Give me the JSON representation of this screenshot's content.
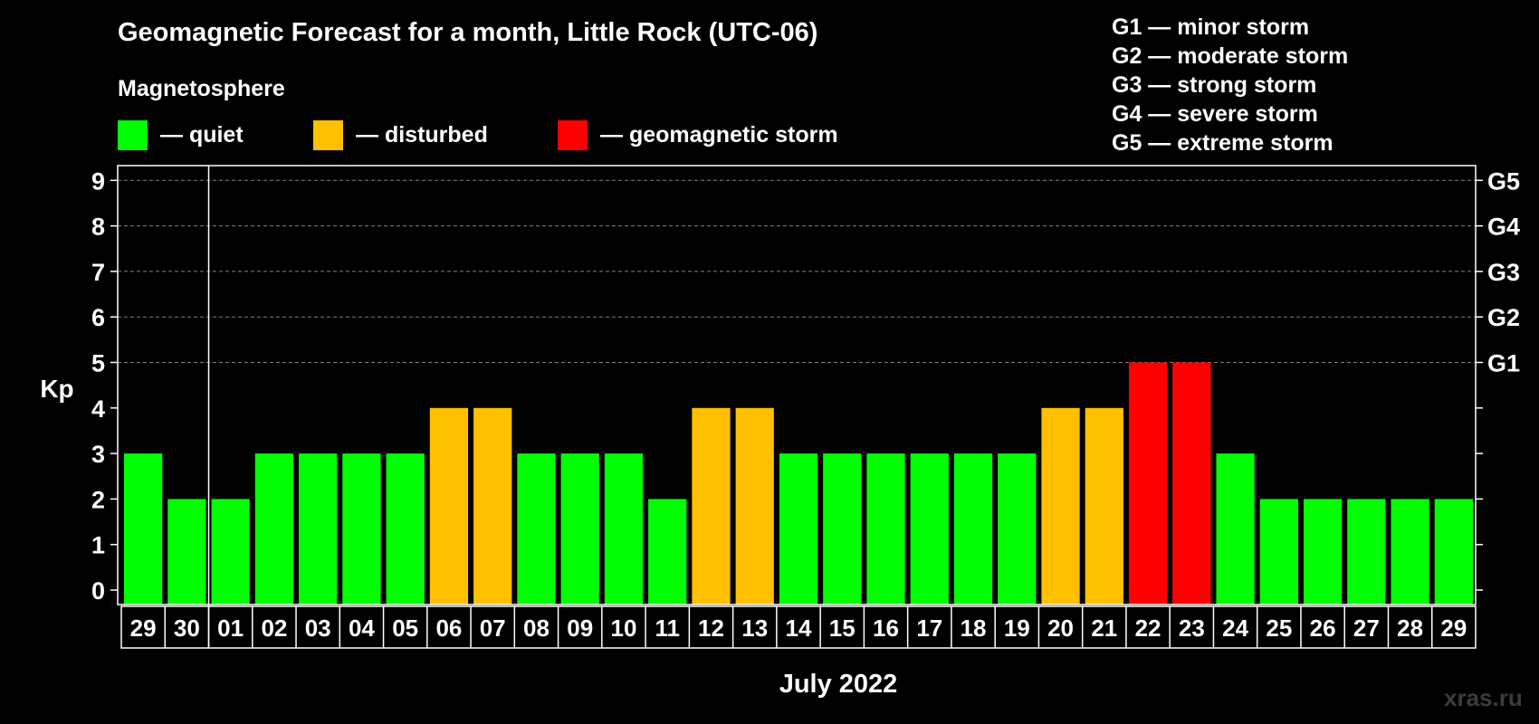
{
  "header": {
    "title": "Geomagnetic Forecast for a month, Little Rock (UTC-06)",
    "subtitle": "Magnetosphere"
  },
  "legend": [
    {
      "label": "— quiet",
      "color": "#00ff00"
    },
    {
      "label": "— disturbed",
      "color": "#ffc000"
    },
    {
      "label": "— geomagnetic storm",
      "color": "#ff0000"
    }
  ],
  "g_scale": [
    "G1 — minor storm",
    "G2 — moderate storm",
    "G3 — strong storm",
    "G4 — severe storm",
    "G5 — extreme storm"
  ],
  "watermark": "xras.ru",
  "colors": {
    "quiet": "#00ff00",
    "disturbed": "#ffc000",
    "storm": "#ff0000",
    "background": "#000000",
    "axis": "#ffffff",
    "grid": "#808080"
  },
  "chart_data": {
    "type": "bar",
    "title": "Geomagnetic Forecast for a month, Little Rock (UTC-06)",
    "xlabel": "July 2022",
    "ylabel": "Kp",
    "ylim": [
      0,
      9
    ],
    "yticks": [
      "0",
      "1",
      "2",
      "3",
      "4",
      "5",
      "6",
      "7",
      "8",
      "9"
    ],
    "right_ticks": [
      {
        "kp": 5,
        "label": "G1"
      },
      {
        "kp": 6,
        "label": "G2"
      },
      {
        "kp": 7,
        "label": "G3"
      },
      {
        "kp": 8,
        "label": "G4"
      },
      {
        "kp": 9,
        "label": "G5"
      }
    ],
    "grid": "dashed at Kp 5–9",
    "month_boundary_after": "30",
    "categories": [
      "29",
      "30",
      "01",
      "02",
      "03",
      "04",
      "05",
      "06",
      "07",
      "08",
      "09",
      "10",
      "11",
      "12",
      "13",
      "14",
      "15",
      "16",
      "17",
      "18",
      "19",
      "20",
      "21",
      "22",
      "23",
      "24",
      "25",
      "26",
      "27",
      "28",
      "29"
    ],
    "values": [
      3,
      2,
      2,
      3,
      3,
      3,
      3,
      4,
      4,
      3,
      3,
      3,
      2,
      4,
      4,
      3,
      3,
      3,
      3,
      3,
      3,
      4,
      4,
      5,
      5,
      3,
      2,
      2,
      2,
      2,
      2
    ]
  }
}
